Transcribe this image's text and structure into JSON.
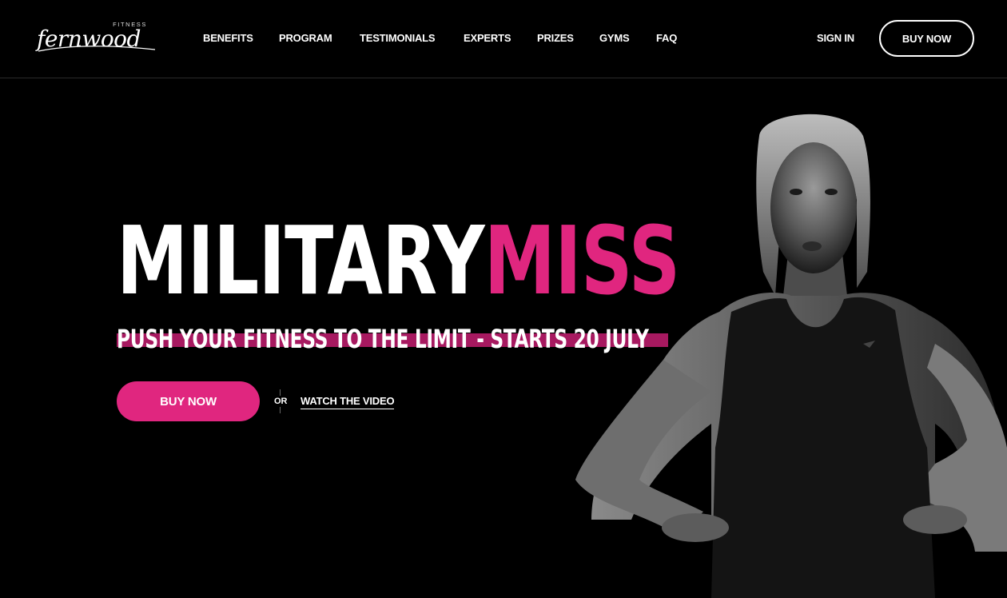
{
  "brand": {
    "name": "fernwood",
    "tag": "FITNESS"
  },
  "nav": {
    "items": [
      {
        "label": "BENEFITS"
      },
      {
        "label": "PROGRAM"
      },
      {
        "label": "TESTIMONIALS"
      },
      {
        "label": "EXPERTS"
      },
      {
        "label": "PRIZES"
      },
      {
        "label": "GYMS"
      },
      {
        "label": "FAQ"
      }
    ],
    "sign_in": "SIGN IN",
    "buy_now": "BUY NOW"
  },
  "hero": {
    "title_white": "MILITARY",
    "title_pink": "MISS",
    "tagline": "PUSH YOUR FITNESS TO THE LIMIT - STARTS 20 JULY",
    "buy_now": "BUY NOW",
    "or_text": "OR",
    "watch_video": "WATCH THE VIDEO"
  },
  "colors": {
    "accent": "#e0267f",
    "tagline_bar": "#a71960",
    "background": "#000000",
    "text": "#ffffff"
  }
}
